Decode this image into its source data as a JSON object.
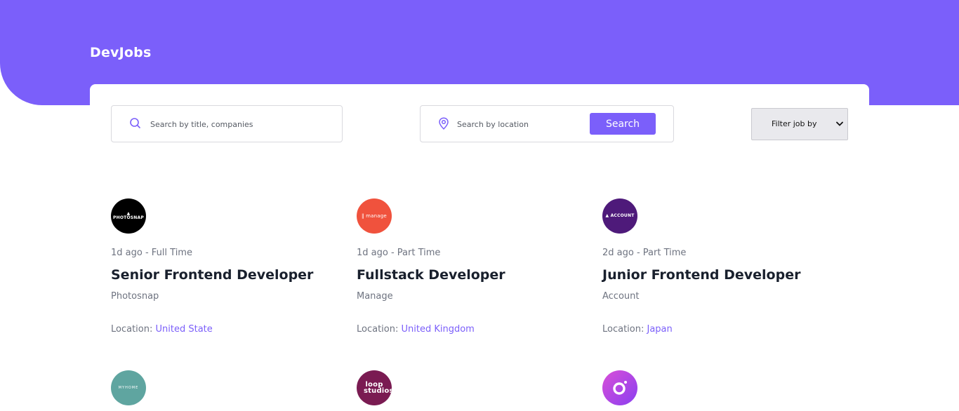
{
  "brand": {
    "name": "DevJobs"
  },
  "search": {
    "title_placeholder": "Search by title, companies",
    "location_placeholder": "Search by location",
    "button_label": "Search",
    "filter_label": "Filter job by"
  },
  "colors": {
    "accent": "#7b5ffa",
    "heading": "#19202d",
    "muted": "#6e7380"
  },
  "jobs": [
    {
      "posted": "1d ago",
      "separator": " - ",
      "contract": "Full Time",
      "title": "Senior Frontend Developer",
      "company": "Photosnap",
      "location_label": "Location: ",
      "location": "United State",
      "logo_text": "▲ PHOTOSNAP",
      "logo_color": "#000000"
    },
    {
      "posted": "1d ago",
      "separator": " - ",
      "contract": "Part Time",
      "title": "Fullstack Developer",
      "company": "Manage",
      "location_label": "Location: ",
      "location": "United Kingdom",
      "logo_text": "‖ manage",
      "logo_color": "#f0523d"
    },
    {
      "posted": "2d ago",
      "separator": " - ",
      "contract": "Part Time",
      "title": "Junior Frontend Developer",
      "company": "Account",
      "location_label": "Location: ",
      "location": "Japan",
      "logo_text": "▲ ACCOUNT",
      "logo_color": "#4e1a7a"
    }
  ],
  "more_logos": [
    {
      "logo_text": "MYHOME",
      "logo_color": "#5fa5a0"
    },
    {
      "logo_text": "loop studios",
      "logo_color": "#7a1b52"
    },
    {
      "logo_text": "",
      "logo_color": "#b748e0"
    }
  ]
}
